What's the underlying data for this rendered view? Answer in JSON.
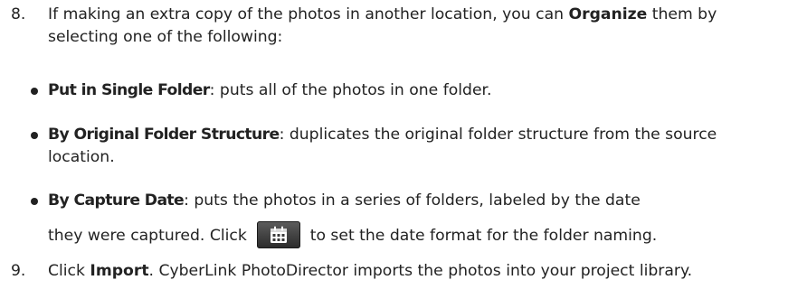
{
  "step8": {
    "number": "8.",
    "text_a": "If making an extra copy of the photos in another location, you can ",
    "bold": "Organize",
    "text_b": " them by selecting one of the following:"
  },
  "bullets": [
    {
      "term": "Put in Single Folder",
      "text": ": puts all of the photos in one folder."
    },
    {
      "term": "By Original Folder Structure",
      "text": ": duplicates the original folder structure from the source location."
    },
    {
      "term": "By Capture Date",
      "text_a": ": puts the photos in a series of folders, labeled by the date",
      "text_b": "they were captured. Click ",
      "icon": "calendar-icon",
      "text_c": " to set the date format for the folder naming."
    }
  ],
  "step9": {
    "number": "9.",
    "text_a": "Click ",
    "bold": "Import",
    "text_b": ". CyberLink PhotoDirector imports the photos into your project library."
  }
}
